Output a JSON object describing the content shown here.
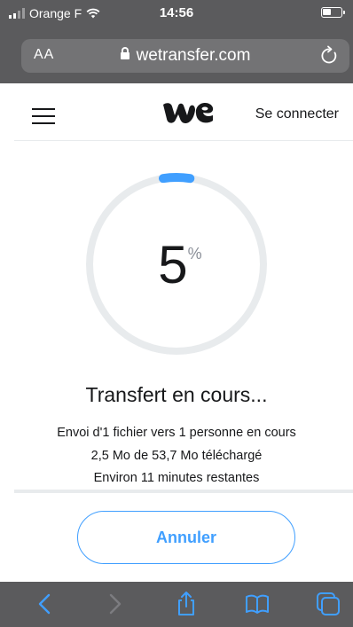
{
  "status_bar": {
    "carrier": "Orange F",
    "time": "14:56"
  },
  "browser": {
    "text_size_label": "AA",
    "domain": "wetransfer.com"
  },
  "header": {
    "signin_label": "Se connecter"
  },
  "progress": {
    "percent": "5",
    "percent_unit": "%",
    "fraction": 0.05
  },
  "transfer": {
    "title": "Transfert en cours...",
    "recipients": "Envoi d'1 fichier vers 1 personne en cours",
    "size": "2,5 Mo de 53,7 Mo téléchargé",
    "remaining": "Environ 11 minutes restantes"
  },
  "actions": {
    "cancel_label": "Annuler"
  },
  "colors": {
    "accent": "#409fff",
    "track": "#e8ebed",
    "chrome": "#5b5b5d"
  }
}
